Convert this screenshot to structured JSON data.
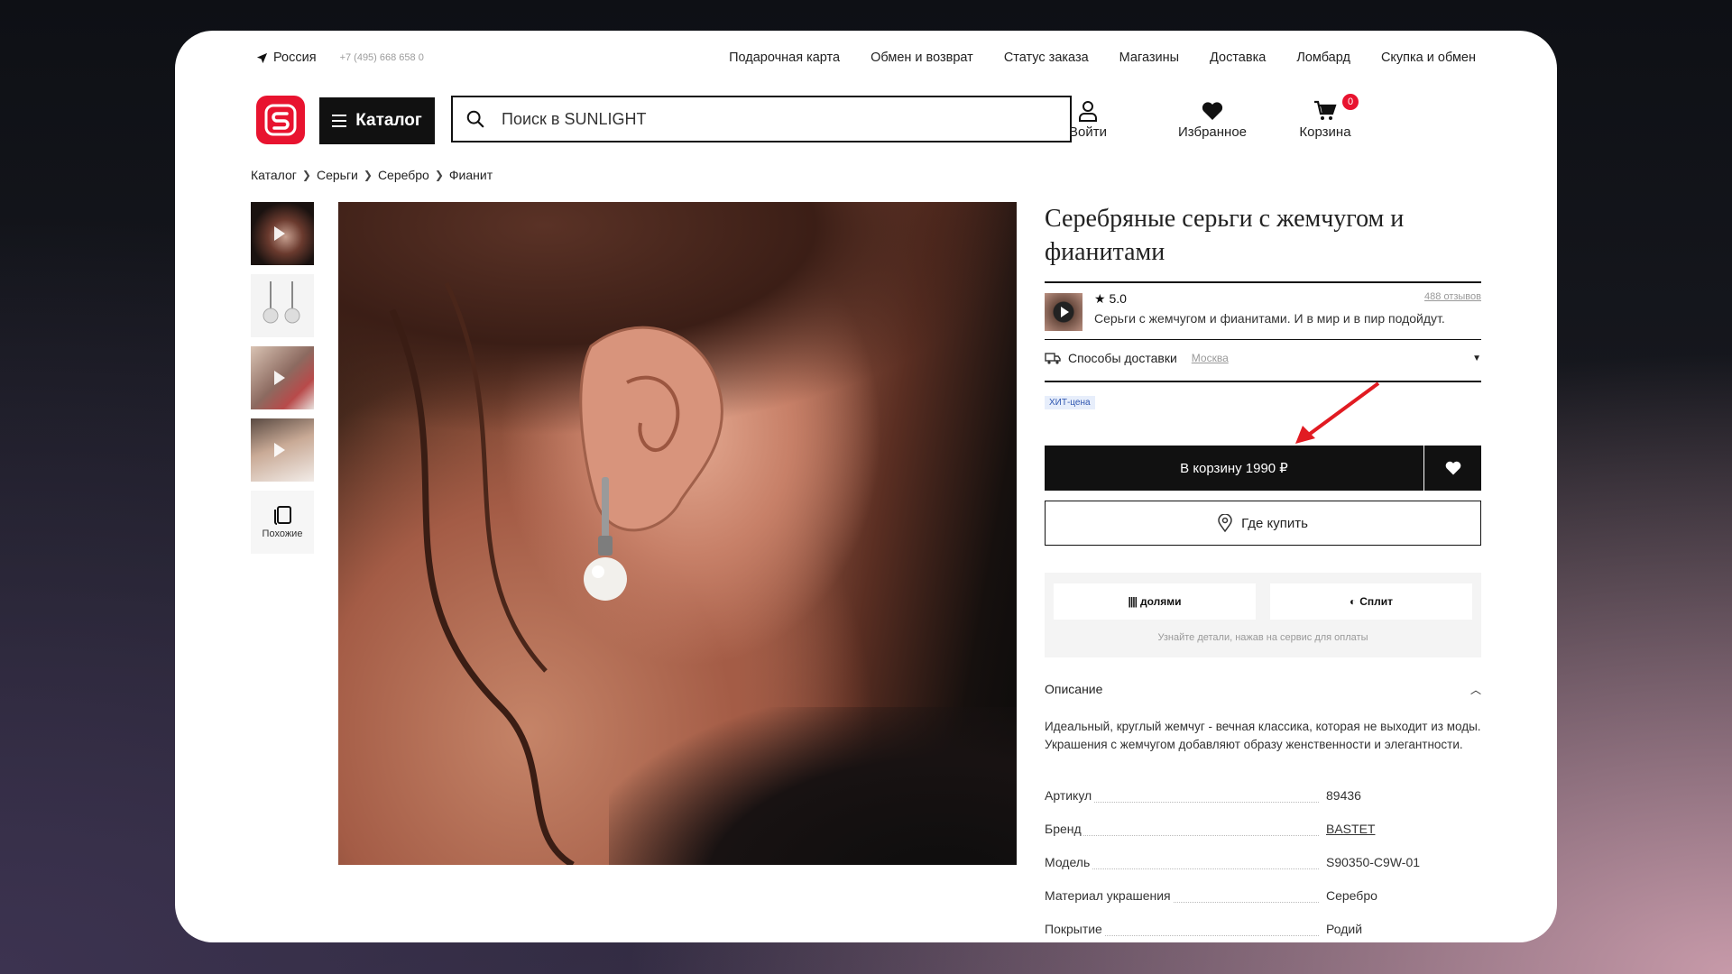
{
  "topbar": {
    "location": "Россия",
    "phone": "+7 (495) 668 658 0",
    "nav": [
      "Подарочная карта",
      "Обмен и возврат",
      "Статус заказа",
      "Магазины",
      "Доставка",
      "Ломбард",
      "Скупка и обмен"
    ]
  },
  "header": {
    "catalog_label": "Каталог",
    "search_placeholder": "Поиск в SUNLIGHT",
    "login_label": "Войти",
    "favorites_label": "Избранное",
    "cart_label": "Корзина",
    "cart_count": "0"
  },
  "breadcrumb": [
    "Каталог",
    "Серьги",
    "Серебро",
    "Фианит"
  ],
  "thumbs": {
    "similar_label": "Похожие"
  },
  "product": {
    "title": "Серебряные серьги с жемчугом и фианитами",
    "rating": "5.0",
    "reviews_count": "488 отзывов",
    "review_text": "Серьги с жемчугом и фианитами. И в мир и в пир подойдут.",
    "delivery_label": "Способы доставки",
    "delivery_city": "Москва",
    "hit_badge": "ХИТ-цена",
    "buy_label": "В корзину 1990 ₽",
    "where_label": "Где купить",
    "pay_option_1": "долями",
    "pay_option_2": "Сплит",
    "pay_note": "Узнайте детали, нажав на сервис для оплаты",
    "description_title": "Описание",
    "description_text": "Идеальный, круглый жемчуг - вечная классика, которая не выходит из моды. Украшения с жемчугом добавляют образу женственности и элегантности.",
    "specs": [
      {
        "k": "Артикул",
        "v": "89436"
      },
      {
        "k": "Бренд",
        "v": "BASTET"
      },
      {
        "k": "Модель",
        "v": "S90350-C9W-01"
      },
      {
        "k": "Материал украшения",
        "v": "Серебро"
      },
      {
        "k": "Покрытие",
        "v": "Родий"
      }
    ]
  },
  "colors": {
    "brand_red": "#e8132f",
    "black": "#111111",
    "annotation_arrow": "#e11b22"
  }
}
